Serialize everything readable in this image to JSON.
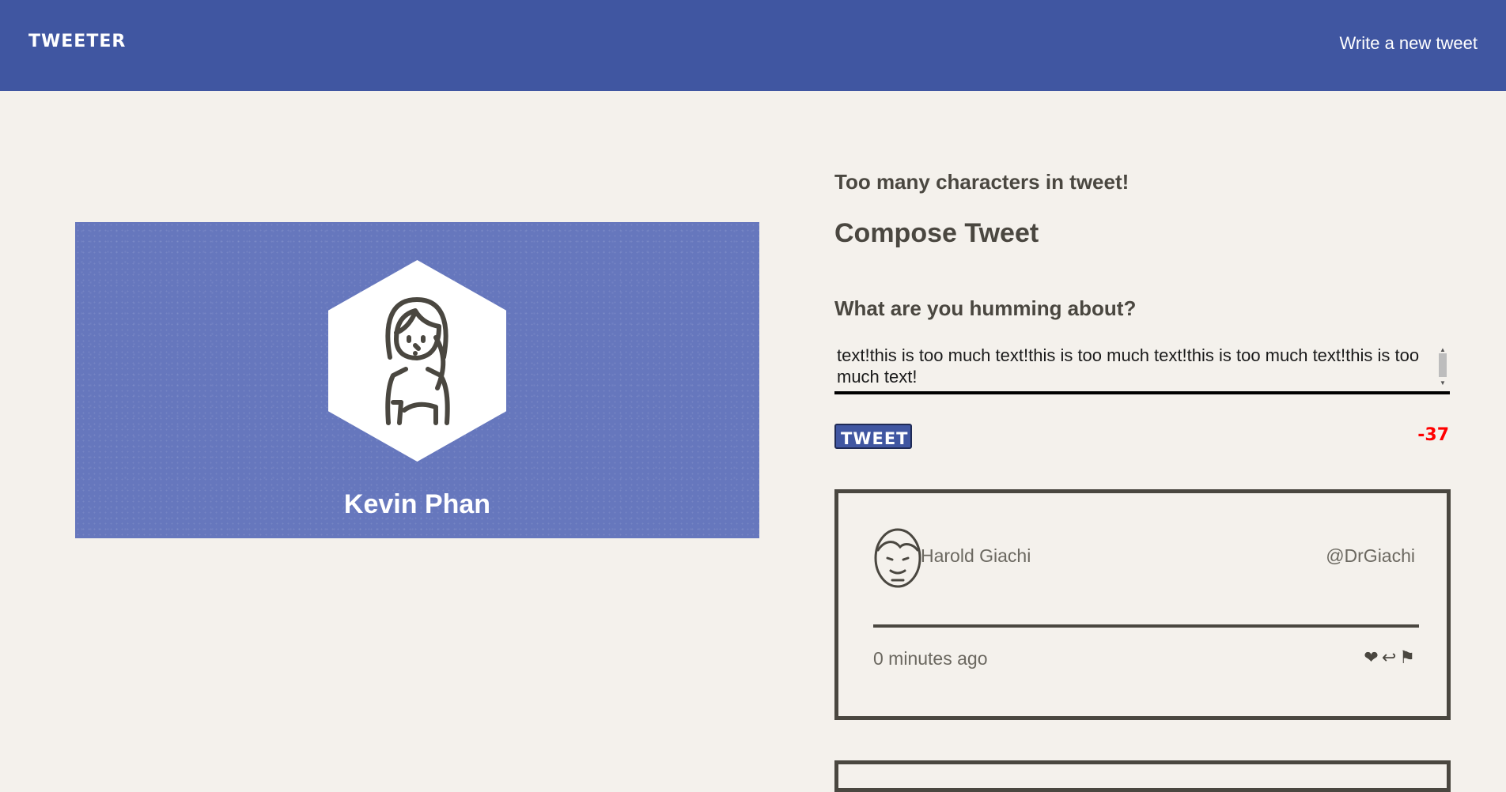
{
  "nav": {
    "brand": "TWEETER",
    "compose_link": "Write a new tweet"
  },
  "profile": {
    "name": "Kevin Phan",
    "avatar_icon": "woman-avatar-icon"
  },
  "compose": {
    "error": "Too many characters in tweet!",
    "title": "Compose Tweet",
    "prompt": "What are you humming about?",
    "text": "text!this is too much text!this is too much text!this is too much text!this is too much text!",
    "button_label": "TWEET",
    "counter": "-37"
  },
  "tweets": [
    {
      "name": "Harold Giachi",
      "handle": "@DrGiachi",
      "time": "0 minutes ago",
      "avatar_icon": "man-avatar-icon",
      "actions": {
        "like": "❤",
        "retweet": "↩",
        "flag": "⚑"
      }
    }
  ],
  "colors": {
    "nav_bg": "#4056a1",
    "page_bg": "#f4f1ec",
    "card_bg": "#6677bd",
    "counter_over": "#ff0000"
  }
}
